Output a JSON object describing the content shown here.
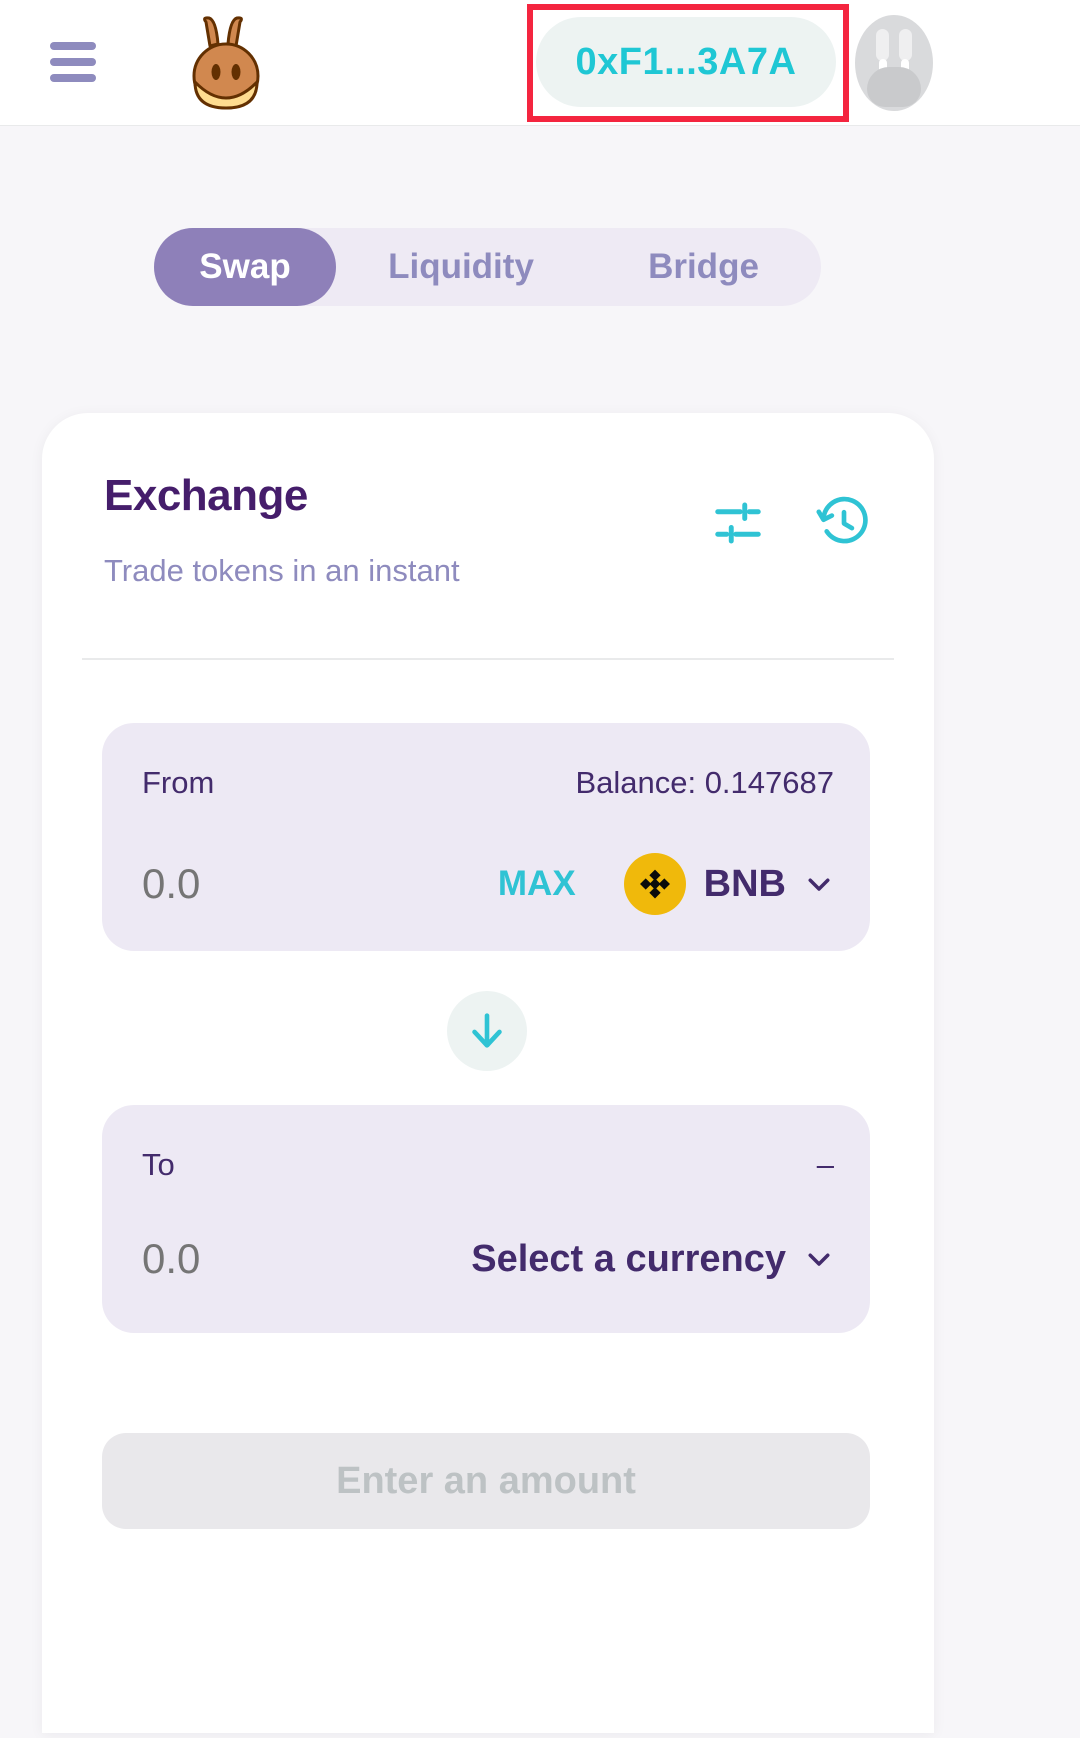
{
  "header": {
    "menu_icon": "hamburger-menu-icon",
    "logo_icon": "pancakeswap-bunny-logo",
    "wallet_label": "0xF1...3A7A",
    "avatar_icon": "bunny-avatar-icon",
    "highlight_color": "#F4253F"
  },
  "tabs": [
    {
      "label": "Swap",
      "active": true
    },
    {
      "label": "Liquidity",
      "active": false
    },
    {
      "label": "Bridge",
      "active": false
    }
  ],
  "card": {
    "title": "Exchange",
    "subtitle": "Trade tokens in an instant",
    "settings_icon": "settings-sliders-icon",
    "history_icon": "history-clock-icon"
  },
  "swap": {
    "from": {
      "label": "From",
      "balance_label": "Balance: 0.147687",
      "amount": "",
      "amount_placeholder": "0.0",
      "max_label": "MAX",
      "token_symbol": "BNB",
      "token_logo": "binance-coin-icon",
      "chevron_icon": "chevron-down-icon"
    },
    "switch_icon": "arrow-down-icon",
    "to": {
      "label": "To",
      "balance_label": "–",
      "amount": "",
      "amount_placeholder": "0.0",
      "select_label": "Select a currency",
      "chevron_icon": "chevron-down-icon"
    },
    "action_label": "Enter an amount"
  },
  "colors": {
    "accent_teal": "#1FC7D4",
    "brand_purple": "#8E80B9",
    "text_dark": "#432B6C",
    "text_muted": "#8E8BBE",
    "panel_bg": "#EDE9F4",
    "binance_yellow": "#F0B90B"
  }
}
